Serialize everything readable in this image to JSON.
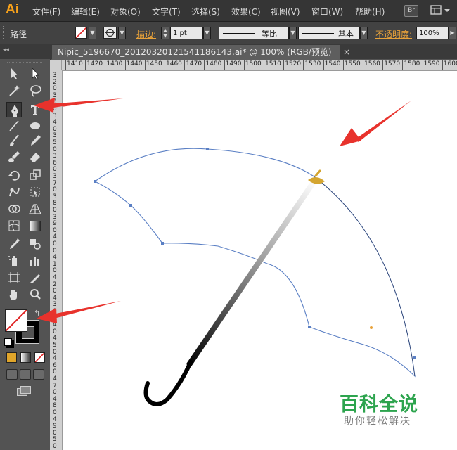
{
  "app": {
    "logo": "Ai"
  },
  "menu": [
    {
      "id": "file",
      "label": "文件(F)"
    },
    {
      "id": "edit",
      "label": "编辑(E)"
    },
    {
      "id": "object",
      "label": "对象(O)"
    },
    {
      "id": "type",
      "label": "文字(T)"
    },
    {
      "id": "select",
      "label": "选择(S)"
    },
    {
      "id": "effect",
      "label": "效果(C)"
    },
    {
      "id": "view",
      "label": "视图(V)"
    },
    {
      "id": "window",
      "label": "窗口(W)"
    },
    {
      "id": "help",
      "label": "帮助(H)"
    }
  ],
  "bridge_button": "Br",
  "control": {
    "selection_type": "路径",
    "stroke_label": "描边:",
    "stroke_weight": "1 pt",
    "stroke_profile": "等比",
    "brush": "基本",
    "opacity_label": "不透明度:",
    "opacity_value": "100%",
    "accent_color": "#e8a23a"
  },
  "document_tab": {
    "title": "Nipic_5196670_20120320121541186143.ai* @ 100% (RGB/预览)",
    "close": "×"
  },
  "ruler": {
    "h_ticks": [
      "1410",
      "1420",
      "1430",
      "1440",
      "1450",
      "1460",
      "1470",
      "1480",
      "1490",
      "1500",
      "1510",
      "1520",
      "1530",
      "1540",
      "1550",
      "1560",
      "1570",
      "1580",
      "1590",
      "1600"
    ],
    "v_digits": [
      "3",
      "2",
      "0",
      "3",
      "3",
      "0",
      "3",
      "4",
      "0",
      "3",
      "5",
      "0",
      "3",
      "6",
      "0",
      "3",
      "7",
      "0",
      "3",
      "8",
      "0",
      "3",
      "9",
      "0",
      "4",
      "0",
      "0",
      "4",
      "1",
      "0",
      "4",
      "2",
      "0",
      "4",
      "3",
      "0",
      "4",
      "4",
      "0",
      "4",
      "5",
      "0",
      "4",
      "6",
      "0",
      "4",
      "7",
      "0",
      "4",
      "8",
      "0",
      "4",
      "9",
      "0",
      "5",
      "0",
      "0"
    ]
  },
  "tools": [
    "selection-tool",
    "direct-selection-tool",
    "magic-wand-tool",
    "lasso-tool",
    "pen-tool",
    "type-tool",
    "line-tool",
    "ellipse-tool",
    "paintbrush-tool",
    "pencil-tool",
    "blob-brush-tool",
    "eraser-tool",
    "rotate-tool",
    "scale-tool",
    "warp-tool",
    "free-transform-tool",
    "shape-builder-tool",
    "perspective-grid-tool",
    "mesh-tool",
    "gradient-tool",
    "eyedropper-tool",
    "blend-tool",
    "symbol-sprayer-tool",
    "column-graph-tool",
    "artboard-tool",
    "slice-tool",
    "hand-tool",
    "zoom-tool"
  ],
  "colors": {
    "fill": "none",
    "stroke": "#000000",
    "umbrella_path": "#5a7fc4",
    "arrow": "#e8322c",
    "tip": "#d4a530"
  },
  "watermark": {
    "title": "百科全说",
    "subtitle": "助你轻松解决"
  }
}
